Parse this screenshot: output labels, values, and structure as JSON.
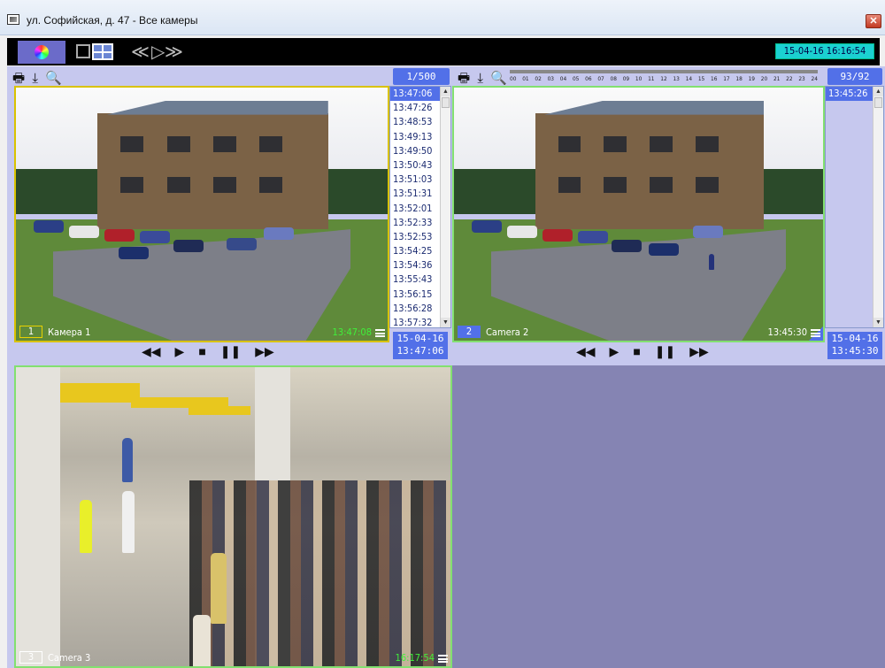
{
  "window": {
    "title": "ул. Софийская, д. 47 - Все камеры",
    "close_glyph": "✕"
  },
  "toolbar": {
    "datetime": "15-04-16  16:16:54"
  },
  "panel_icons": {
    "print": "🖶",
    "export": "⤓",
    "search": "🔍"
  },
  "camera1": {
    "pager": "1/500",
    "num": "1",
    "name": "Камера 1",
    "time": "13:47:08",
    "date": "15-04-16",
    "clock": "13:47:06",
    "events": [
      "13:47:06",
      "13:47:26",
      "13:48:53",
      "13:49:13",
      "13:49:50",
      "13:50:43",
      "13:51:03",
      "13:51:31",
      "13:52:01",
      "13:52:33",
      "13:52:53",
      "13:54:25",
      "13:54:36",
      "13:55:43",
      "13:56:15",
      "13:56:28",
      "13:57:32"
    ]
  },
  "camera2": {
    "pager": "93/92",
    "num": "2",
    "name": "Camera 2",
    "time": "13:45:30",
    "date": "15-04-16",
    "clock": "13:45:30",
    "events": [
      "13:45:26"
    ],
    "timeline_ticks": [
      "00",
      "01",
      "02",
      "03",
      "04",
      "05",
      "06",
      "07",
      "08",
      "09",
      "10",
      "11",
      "12",
      "13",
      "14",
      "15",
      "16",
      "17",
      "18",
      "19",
      "20",
      "21",
      "22",
      "23",
      "24"
    ]
  },
  "camera3": {
    "num": "3",
    "name": "Camera 3",
    "time": "16:17:54"
  },
  "controls": {
    "rewind": "◀◀",
    "play": "▶",
    "stop": "■",
    "pause": "❚❚",
    "forward": "▶▶"
  },
  "colors": {
    "accent": "#5270e8",
    "panel_bg": "#c6c8ee",
    "empty_bg": "#8584b3",
    "cam_time": "#3ff03a"
  }
}
